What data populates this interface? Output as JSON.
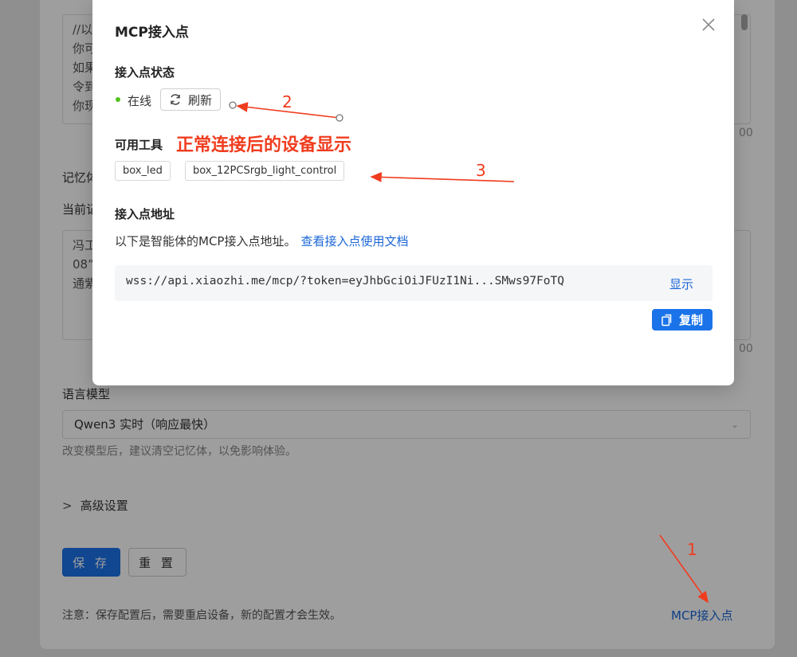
{
  "background": {
    "prompt_lines": [
      "//以",
      "你可",
      "如果",
      "令到",
      "你现"
    ],
    "top_count_suffix": "00",
    "memory_label": "记忆体",
    "current_label": "当前记",
    "memory_lines": [
      "冯工",
      "08”",
      "通紫"
    ],
    "memory_count_suffix": "00",
    "language_model_label": "语言模型",
    "language_model_value": "Qwen3 实时（响应最快）",
    "model_hint": "改变模型后，建议清空记忆体，以免影响体验。",
    "advanced_label": "高级设置",
    "save_label": "保 存",
    "reset_label": "重 置",
    "note": "注意：保存配置后，需要重启设备，新的配置才会生效。",
    "mcp_link": "MCP接入点"
  },
  "modal": {
    "title": "MCP接入点",
    "status_section": "接入点状态",
    "status_text": "在线",
    "status_color": "#52c41a",
    "refresh_label": "刷新",
    "tools_section": "可用工具",
    "tools": [
      "box_led",
      "box_12PCSrgb_light_control"
    ],
    "address_section": "接入点地址",
    "address_desc": "以下是智能体的MCP接入点地址。",
    "address_doc_link": "查看接入点使用文档",
    "url": "wss://api.xiaozhi.me/mcp/?token=eyJhbGciOiJFUzI1Ni...SMws97FoTQ",
    "show_label": "显示",
    "copy_label": "复制"
  },
  "annotations": {
    "device_note": "正常连接后的设备显示",
    "marker_1": "1",
    "marker_2": "2",
    "marker_3": "3",
    "color": "#f03c1e"
  },
  "colors": {
    "accent": "#1a73e8",
    "link": "#1a66d9"
  }
}
